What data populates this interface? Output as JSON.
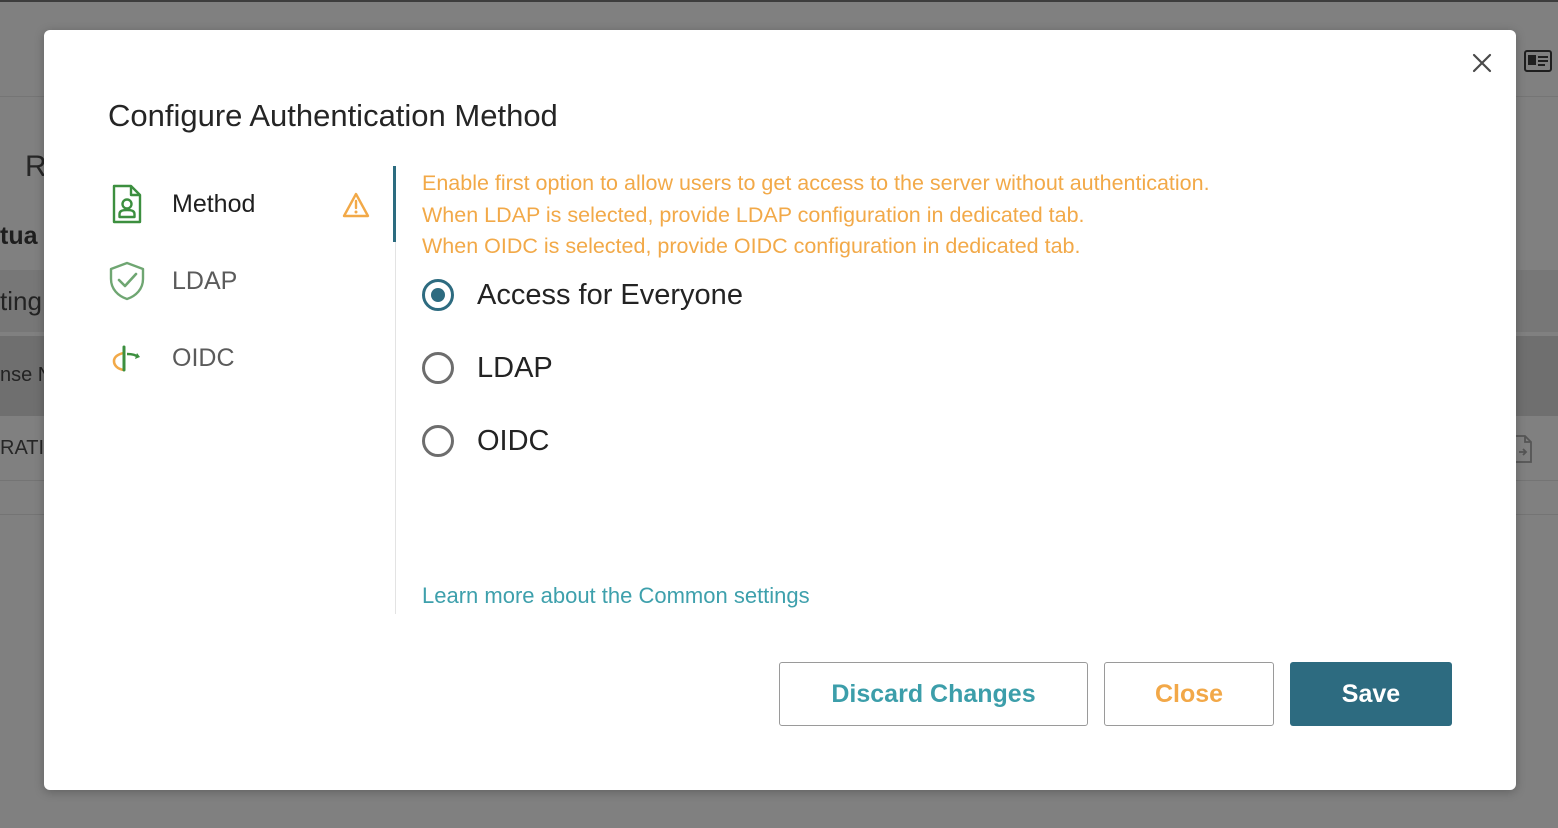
{
  "background": {
    "page_letter": "R",
    "section_fragment": "tua",
    "band1_fragment": "ting",
    "band2_fragment": "nse N",
    "row_fragment": "RATI"
  },
  "modal": {
    "title": "Configure Authentication Method",
    "close_icon": "close-icon",
    "nav": [
      {
        "label": "Method",
        "icon": "document-user-icon",
        "active": true,
        "warning": true
      },
      {
        "label": "LDAP",
        "icon": "shield-check-icon",
        "active": false
      },
      {
        "label": "OIDC",
        "icon": "openid-icon",
        "active": false
      }
    ],
    "info_lines": [
      "Enable first option to allow users to get access to the server without authentication.",
      "When LDAP is selected, provide LDAP configuration in dedicated tab.",
      "When OIDC is selected, provide OIDC configuration in dedicated tab."
    ],
    "options": [
      {
        "label": "Access for Everyone",
        "checked": true
      },
      {
        "label": "LDAP",
        "checked": false
      },
      {
        "label": "OIDC",
        "checked": false
      }
    ],
    "learn_more": "Learn more about the Common settings",
    "buttons": {
      "discard": "Discard Changes",
      "close": "Close",
      "save": "Save"
    }
  },
  "colors": {
    "accent": "#2d6b80",
    "warning": "#f2a948",
    "link": "#3ea0ac",
    "nav_icon_green": "#3c8f3f"
  }
}
